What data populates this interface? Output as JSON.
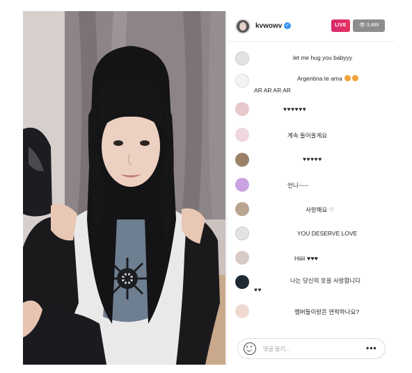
{
  "stream": {
    "username": "kvwowv",
    "live_label": "LIVE",
    "viewer_count": "3,489",
    "icons": {
      "verified": "verified-badge-icon",
      "viewers": "eye-icon"
    }
  },
  "comments": [
    {
      "text": "let me hug you babyyy"
    },
    {
      "text": "Argentina te ama",
      "tail": "AR AR AR AR"
    },
    {
      "text": "♥♥♥♥♥♥"
    },
    {
      "text": "계속 들어올게요"
    },
    {
      "text": "♥♥♥♥♥"
    },
    {
      "text": "언니~~~"
    },
    {
      "text": "사랑해요 ♡"
    },
    {
      "text": "YOU DESERVE LOVE"
    },
    {
      "text": "Hiiiii",
      "hearts": "♥♥♥"
    },
    {
      "text": "나는 당신의 옷을 사랑합니다",
      "hearts": "♥♥"
    },
    {
      "text": "멤버들이랑은 연락하나요?"
    }
  ],
  "footer": {
    "placeholder": "댓글 달기...",
    "more_label": "•••"
  },
  "colors": {
    "live": "#d62a6e",
    "verified": "#3897f0",
    "viewer_badge": "#8d8d8d",
    "red_heart": "#d9263b",
    "yellow_heart": "#f2c500"
  }
}
